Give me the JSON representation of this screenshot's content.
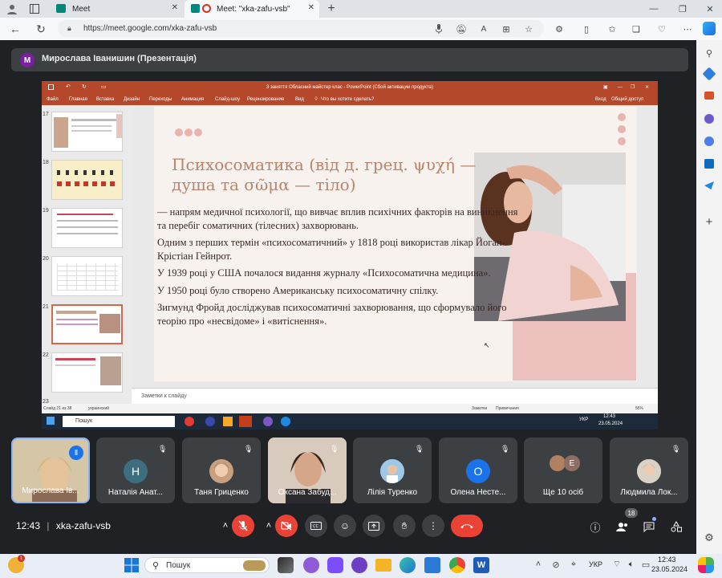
{
  "browser": {
    "tabs": [
      {
        "label": "Meet"
      },
      {
        "label": "Meet: \"xka-zafu-vsb\""
      }
    ],
    "url": "https://meet.google.com/xka-zafu-vsb"
  },
  "meet": {
    "presenter": {
      "initial": "М",
      "title": "Мирослава Іванишин (Презентація)"
    },
    "time": "12:43",
    "separator": "|",
    "meeting_code": "xka-zafu-vsb",
    "people_count": "18",
    "participants": [
      {
        "name": "Мирослава Ів...",
        "type": "video",
        "speaking": true
      },
      {
        "name": "Наталія Анат...",
        "type": "avatar",
        "initial": "Н",
        "color": "#3c6e7f"
      },
      {
        "name": "Таня Гриценко",
        "type": "photo"
      },
      {
        "name": "Оксана Забуд...",
        "type": "video"
      },
      {
        "name": "Лілія Туренко",
        "type": "photo"
      },
      {
        "name": "Олена Несте...",
        "type": "avatar",
        "initial": "О",
        "color": "#1a73e8"
      },
      {
        "name": "Ще 10 осіб",
        "type": "more",
        "initial": "Е"
      },
      {
        "name": "Людмила Лок...",
        "type": "photo"
      }
    ]
  },
  "powerpoint": {
    "window_title": "3 заняття Обласний майстер клас - PowerPoint (Сбой активации продукта)",
    "ribbon_tabs": [
      "Файл",
      "Главная",
      "Вставка",
      "Дизайн",
      "Переходы",
      "Анимация",
      "Слайд-шоу",
      "Рецензирование",
      "Вид"
    ],
    "tell_me": "Что вы хотите сделать?",
    "sign_in": "Вход",
    "share": "Общий доступ",
    "slide_numbers": [
      "17",
      "18",
      "19",
      "20",
      "21",
      "22",
      "23"
    ],
    "slide": {
      "title": "Психосоматика (від д. грец. ψυχή — душа та σῶμα — тіло)",
      "paragraphs": [
        "— напрям медичної психології, що вивчає вплив психічних факторів на виникнення та перебіг соматичних (тілесних) захворювань.",
        "Одним з перших термін «психосоматичний» у 1818 році використав лікар Йоган-Крістіан Гейнрот.",
        "У 1939 році у США почалося видання журналу «Психосоматична медицина».",
        "У 1950 році було створено Американську психосоматичну спілку.",
        "Зигмунд Фройд досліджував психосоматичні захворювання, що сформувало його теорію про «несвідоме» і «витіснення»."
      ]
    },
    "notes_placeholder": "Заметки к слайду",
    "status_left": "Слайд 21 из 38",
    "status_lang": "украинский",
    "status_notes": "Заметки",
    "status_comments": "Примечания",
    "zoom": "55%",
    "taskbar_search": "Пошук",
    "taskbar_lang": "УКР",
    "taskbar_time": "12:43",
    "taskbar_date": "23.05.2024"
  },
  "windows_taskbar": {
    "search_placeholder": "Пошук",
    "lang": "УКР",
    "time": "12:43",
    "date": "23.05.2024"
  }
}
